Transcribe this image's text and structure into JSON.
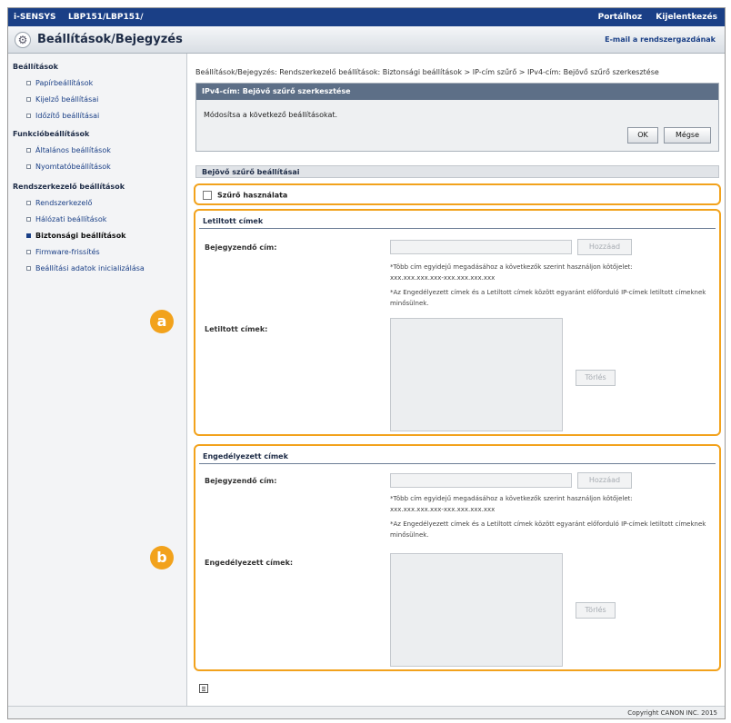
{
  "header": {
    "brand": "i-SENSYS",
    "model": "LBP151/LBP151/",
    "portal_link": "Portálhoz",
    "logout_link": "Kijelentkezés",
    "page_title": "Beállítások/Bejegyzés",
    "mail_link": "E-mail a rendszergazdának"
  },
  "sidebar": {
    "sections": [
      {
        "label": "Beállítások",
        "items": [
          "Papírbeállítások",
          "Kijelző beállításai",
          "Időzítő beállításai"
        ]
      },
      {
        "label": "Funkcióbeállítások",
        "items": [
          "Általános beállítások",
          "Nyomtatóbeállítások"
        ]
      },
      {
        "label": "Rendszerkezelő beállítások",
        "items": [
          "Rendszerkezelő",
          "Hálózati beállítások",
          "Biztonsági beállítások",
          "Firmware-frissítés",
          "Beállítási adatok inicializálása"
        ]
      }
    ],
    "active_item": "Biztonsági beállítások"
  },
  "main": {
    "breadcrumb": "Beállítások/Bejegyzés: Rendszerkezelő beállítások: Biztonsági beállítások > IP-cím szűrő > IPv4-cím: Bejövő szűrő szerkesztése",
    "edit_title": "IPv4-cím: Bejövő szűrő szerkesztése",
    "edit_message": "Módosítsa a következő beállításokat.",
    "ok_label": "OK",
    "cancel_label": "Mégse",
    "filter_section_title": "Bejövő szűrő beállításai",
    "use_filter_label": "Szűrő használata",
    "use_filter_checked": false,
    "blocked": {
      "title": "Letiltott címek",
      "register_label": "Bejegyzendő cím:",
      "add_label": "Hozzáad",
      "note1": "*Több cím egyidejű megadásához a következők szerint használjon kötőjelet:",
      "note1b": "xxx.xxx.xxx.xxx-xxx.xxx.xxx.xxx",
      "note2": "*Az Engedélyezett címek és a Letiltott címek között egyaránt előforduló IP-címek letiltott címeknek minősülnek.",
      "list_label": "Letiltott címek:",
      "delete_label": "Törlés"
    },
    "allowed": {
      "title": "Engedélyezett címek",
      "register_label": "Bejegyzendő cím:",
      "add_label": "Hozzáad",
      "note1": "*Több cím egyidejű megadásához a következők szerint használjon kötőjelet:",
      "note1b": "xxx.xxx.xxx.xxx-xxx.xxx.xxx.xxx",
      "note2": "*Az Engedélyezett címek és a Letiltott címek között egyaránt előforduló IP-címek letiltott címeknek minősülnek.",
      "list_label": "Engedélyezett címek:",
      "delete_label": "Törlés"
    }
  },
  "callouts": {
    "a": "a",
    "b": "b"
  },
  "footer": {
    "copyright": "Copyright CANON INC. 2015"
  },
  "colors": {
    "accent_orange": "#f2a21c",
    "top_bar": "#1a3f86"
  }
}
